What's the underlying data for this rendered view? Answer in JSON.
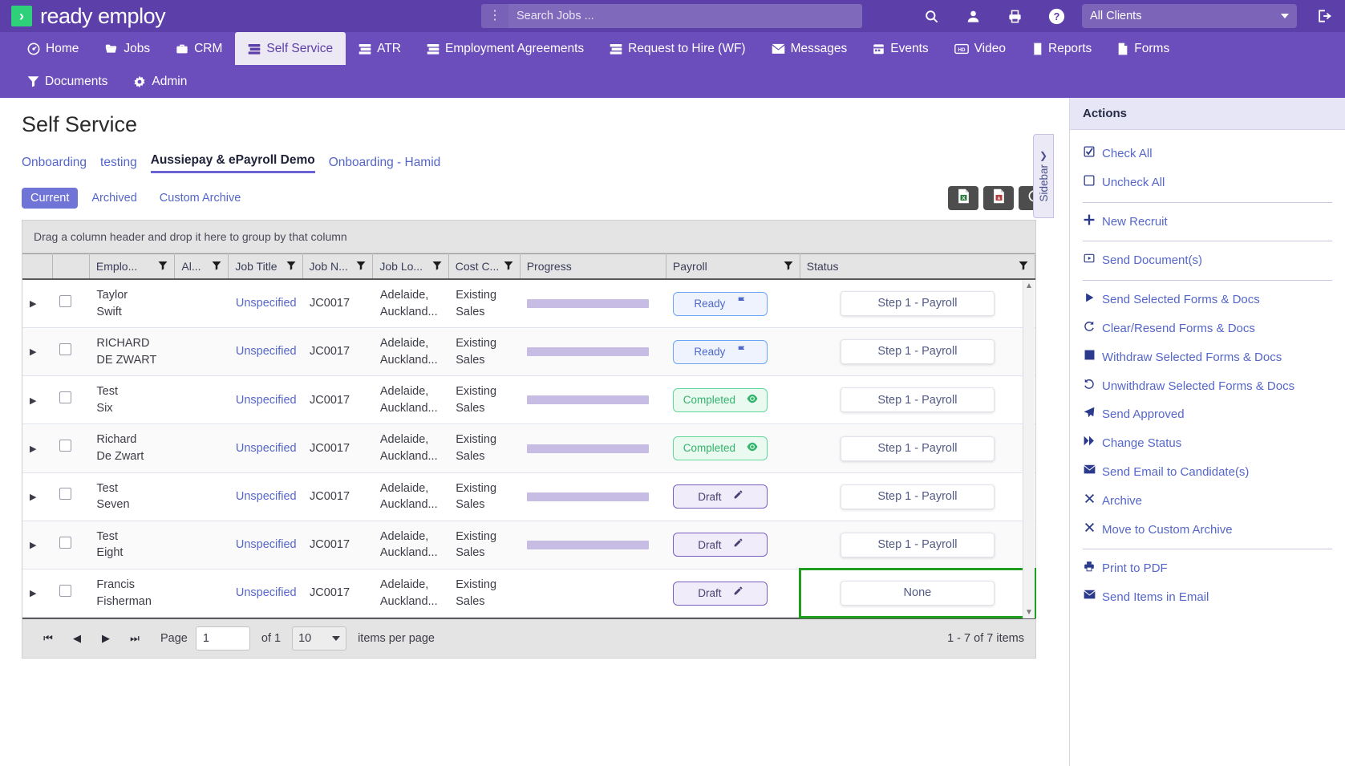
{
  "brand": {
    "name": "ready employ",
    "mark": "chevron-logo"
  },
  "header": {
    "search": {
      "placeholder": "Search Jobs ...",
      "value": ""
    },
    "kebab_icon": "kebab-menu-icon",
    "icons": [
      "search-icon",
      "user-icon",
      "print-icon",
      "help-icon"
    ],
    "client_select": {
      "value": "All Clients"
    },
    "logout_icon": "logout-icon"
  },
  "nav": {
    "row1": [
      {
        "label": "Home",
        "icon": "dashboard-icon",
        "active": false
      },
      {
        "label": "Jobs",
        "icon": "folder-icon",
        "active": false
      },
      {
        "label": "CRM",
        "icon": "briefcase-icon",
        "active": false
      },
      {
        "label": "Self Service",
        "icon": "list-icon",
        "active": true
      },
      {
        "label": "ATR",
        "icon": "list-icon",
        "active": false
      },
      {
        "label": "Employment Agreements",
        "icon": "list-icon",
        "active": false
      },
      {
        "label": "Request to Hire (WF)",
        "icon": "list-icon",
        "active": false
      },
      {
        "label": "Messages",
        "icon": "envelope-icon",
        "active": false
      },
      {
        "label": "Events",
        "icon": "calendar-icon",
        "active": false
      },
      {
        "label": "Video",
        "icon": "video-icon",
        "active": false
      },
      {
        "label": "Reports",
        "icon": "book-icon",
        "active": false
      },
      {
        "label": "Forms",
        "icon": "file-icon",
        "active": false
      }
    ],
    "row2": [
      {
        "label": "Documents",
        "icon": "filter-icon",
        "active": false
      },
      {
        "label": "Admin",
        "icon": "gear-icon",
        "active": false
      }
    ]
  },
  "page": {
    "title": "Self Service",
    "subtabs": [
      {
        "label": "Onboarding",
        "active": false
      },
      {
        "label": "testing",
        "active": false
      },
      {
        "label": "Aussiepay & ePayroll Demo",
        "active": true
      },
      {
        "label": "Onboarding - Hamid",
        "active": false
      }
    ],
    "viewtabs": [
      {
        "label": "Current",
        "active": true
      },
      {
        "label": "Archived",
        "active": false
      },
      {
        "label": "Custom Archive",
        "active": false
      }
    ],
    "export_buttons": [
      {
        "name": "export-excel-button",
        "icon": "excel-file-icon"
      },
      {
        "name": "export-pdf-button",
        "icon": "pdf-file-icon"
      },
      {
        "name": "refresh-button",
        "icon": "refresh-icon"
      }
    ]
  },
  "grid": {
    "group_hint": "Drag a column header and drop it here to group by that column",
    "columns": [
      {
        "label": "",
        "filter": false
      },
      {
        "label": "",
        "filter": false
      },
      {
        "label": "Emplo...",
        "filter": true
      },
      {
        "label": "Al...",
        "filter": true
      },
      {
        "label": "Job Title",
        "filter": true
      },
      {
        "label": "Job N...",
        "filter": true
      },
      {
        "label": "Job Lo...",
        "filter": true
      },
      {
        "label": "Cost C...",
        "filter": true
      },
      {
        "label": "Progress",
        "filter": false
      },
      {
        "label": "Payroll",
        "filter": true
      },
      {
        "label": "Status",
        "filter": true
      }
    ],
    "rows": [
      {
        "employee": "Taylor Swift",
        "alias": "",
        "job_title": "Unspecified",
        "job_number": "JC0017",
        "job_location": "Adelaide, Auckland...",
        "cost_centre": "Existing Sales",
        "progress": true,
        "payroll": {
          "label": "Ready",
          "icon": "flag-icon",
          "state": "ready"
        },
        "status": "Step 1 - Payroll",
        "highlighted": false
      },
      {
        "employee": "RICHARD DE ZWART",
        "alias": "",
        "job_title": "Unspecified",
        "job_number": "JC0017",
        "job_location": "Adelaide, Auckland...",
        "cost_centre": "Existing Sales",
        "progress": true,
        "payroll": {
          "label": "Ready",
          "icon": "flag-icon",
          "state": "ready"
        },
        "status": "Step 1 - Payroll",
        "highlighted": false
      },
      {
        "employee": "Test Six",
        "alias": "",
        "job_title": "Unspecified",
        "job_number": "JC0017",
        "job_location": "Adelaide, Auckland...",
        "cost_centre": "Existing Sales",
        "progress": true,
        "payroll": {
          "label": "Completed",
          "icon": "eye-icon",
          "state": "completed"
        },
        "status": "Step 1 - Payroll",
        "highlighted": false
      },
      {
        "employee": "Richard De Zwart",
        "alias": "",
        "job_title": "Unspecified",
        "job_number": "JC0017",
        "job_location": "Adelaide, Auckland...",
        "cost_centre": "Existing Sales",
        "progress": true,
        "payroll": {
          "label": "Completed",
          "icon": "eye-icon",
          "state": "completed"
        },
        "status": "Step 1 - Payroll",
        "highlighted": false
      },
      {
        "employee": "Test Seven",
        "alias": "",
        "job_title": "Unspecified",
        "job_number": "JC0017",
        "job_location": "Adelaide, Auckland...",
        "cost_centre": "Existing Sales",
        "progress": true,
        "payroll": {
          "label": "Draft",
          "icon": "pencil-icon",
          "state": "draft"
        },
        "status": "Step 1 - Payroll",
        "highlighted": false
      },
      {
        "employee": "Test Eight",
        "alias": "",
        "job_title": "Unspecified",
        "job_number": "JC0017",
        "job_location": "Adelaide, Auckland...",
        "cost_centre": "Existing Sales",
        "progress": true,
        "payroll": {
          "label": "Draft",
          "icon": "pencil-icon",
          "state": "draft"
        },
        "status": "Step 1 - Payroll",
        "highlighted": false
      },
      {
        "employee": "Francis Fisherman",
        "alias": "",
        "job_title": "Unspecified",
        "job_number": "JC0017",
        "job_location": "Adelaide, Auckland...",
        "cost_centre": "Existing Sales",
        "progress": false,
        "payroll": {
          "label": "Draft",
          "icon": "pencil-icon",
          "state": "draft"
        },
        "status": "None",
        "highlighted": true
      }
    ]
  },
  "pager": {
    "first": "first-page-icon",
    "prev": "prev-page-icon",
    "next": "next-page-icon",
    "last": "last-page-icon",
    "page_label": "Page",
    "page_value": "1",
    "of_label": "of 1",
    "page_size": "10",
    "items_per_page_label": "items per page",
    "count_label": "1 - 7 of 7 items"
  },
  "sidebar_toggle": {
    "label": "Sidebar",
    "chevron": "chevron-right-icon"
  },
  "actions": {
    "title": "Actions",
    "items": [
      {
        "label": "Check All",
        "icon": "checkbox-checked-icon",
        "sep_after": false
      },
      {
        "label": "Uncheck All",
        "icon": "checkbox-empty-icon",
        "sep_after": true
      },
      {
        "label": "New Recruit",
        "icon": "plus-icon",
        "sep_after": true
      },
      {
        "label": "Send Document(s)",
        "icon": "play-box-icon",
        "sep_after": true
      },
      {
        "label": "Send Selected Forms & Docs",
        "icon": "play-icon",
        "sep_after": false
      },
      {
        "label": "Clear/Resend Forms & Docs",
        "icon": "refresh-icon",
        "sep_after": false
      },
      {
        "label": "Withdraw Selected Forms & Docs",
        "icon": "square-icon",
        "sep_after": false
      },
      {
        "label": "Unwithdraw Selected Forms & Docs",
        "icon": "undo-icon",
        "sep_after": false
      },
      {
        "label": "Send Approved",
        "icon": "paper-plane-icon",
        "sep_after": false
      },
      {
        "label": "Change Status",
        "icon": "forward-icon",
        "sep_after": false
      },
      {
        "label": "Send Email to Candidate(s)",
        "icon": "envelope-icon",
        "sep_after": false
      },
      {
        "label": "Archive",
        "icon": "close-x-icon",
        "sep_after": false
      },
      {
        "label": "Move to Custom Archive",
        "icon": "close-x-icon",
        "sep_after": true
      },
      {
        "label": "Print to PDF",
        "icon": "print-icon",
        "sep_after": false
      },
      {
        "label": "Send Items in Email",
        "icon": "envelope-icon",
        "sep_after": false
      }
    ]
  },
  "colors": {
    "brand_purple": "#5c3fa8",
    "nav_purple": "#6b4dbb",
    "link_blue": "#5566c9",
    "highlight_green": "#1f9e1f",
    "progress_purple": "#c6bce4"
  }
}
